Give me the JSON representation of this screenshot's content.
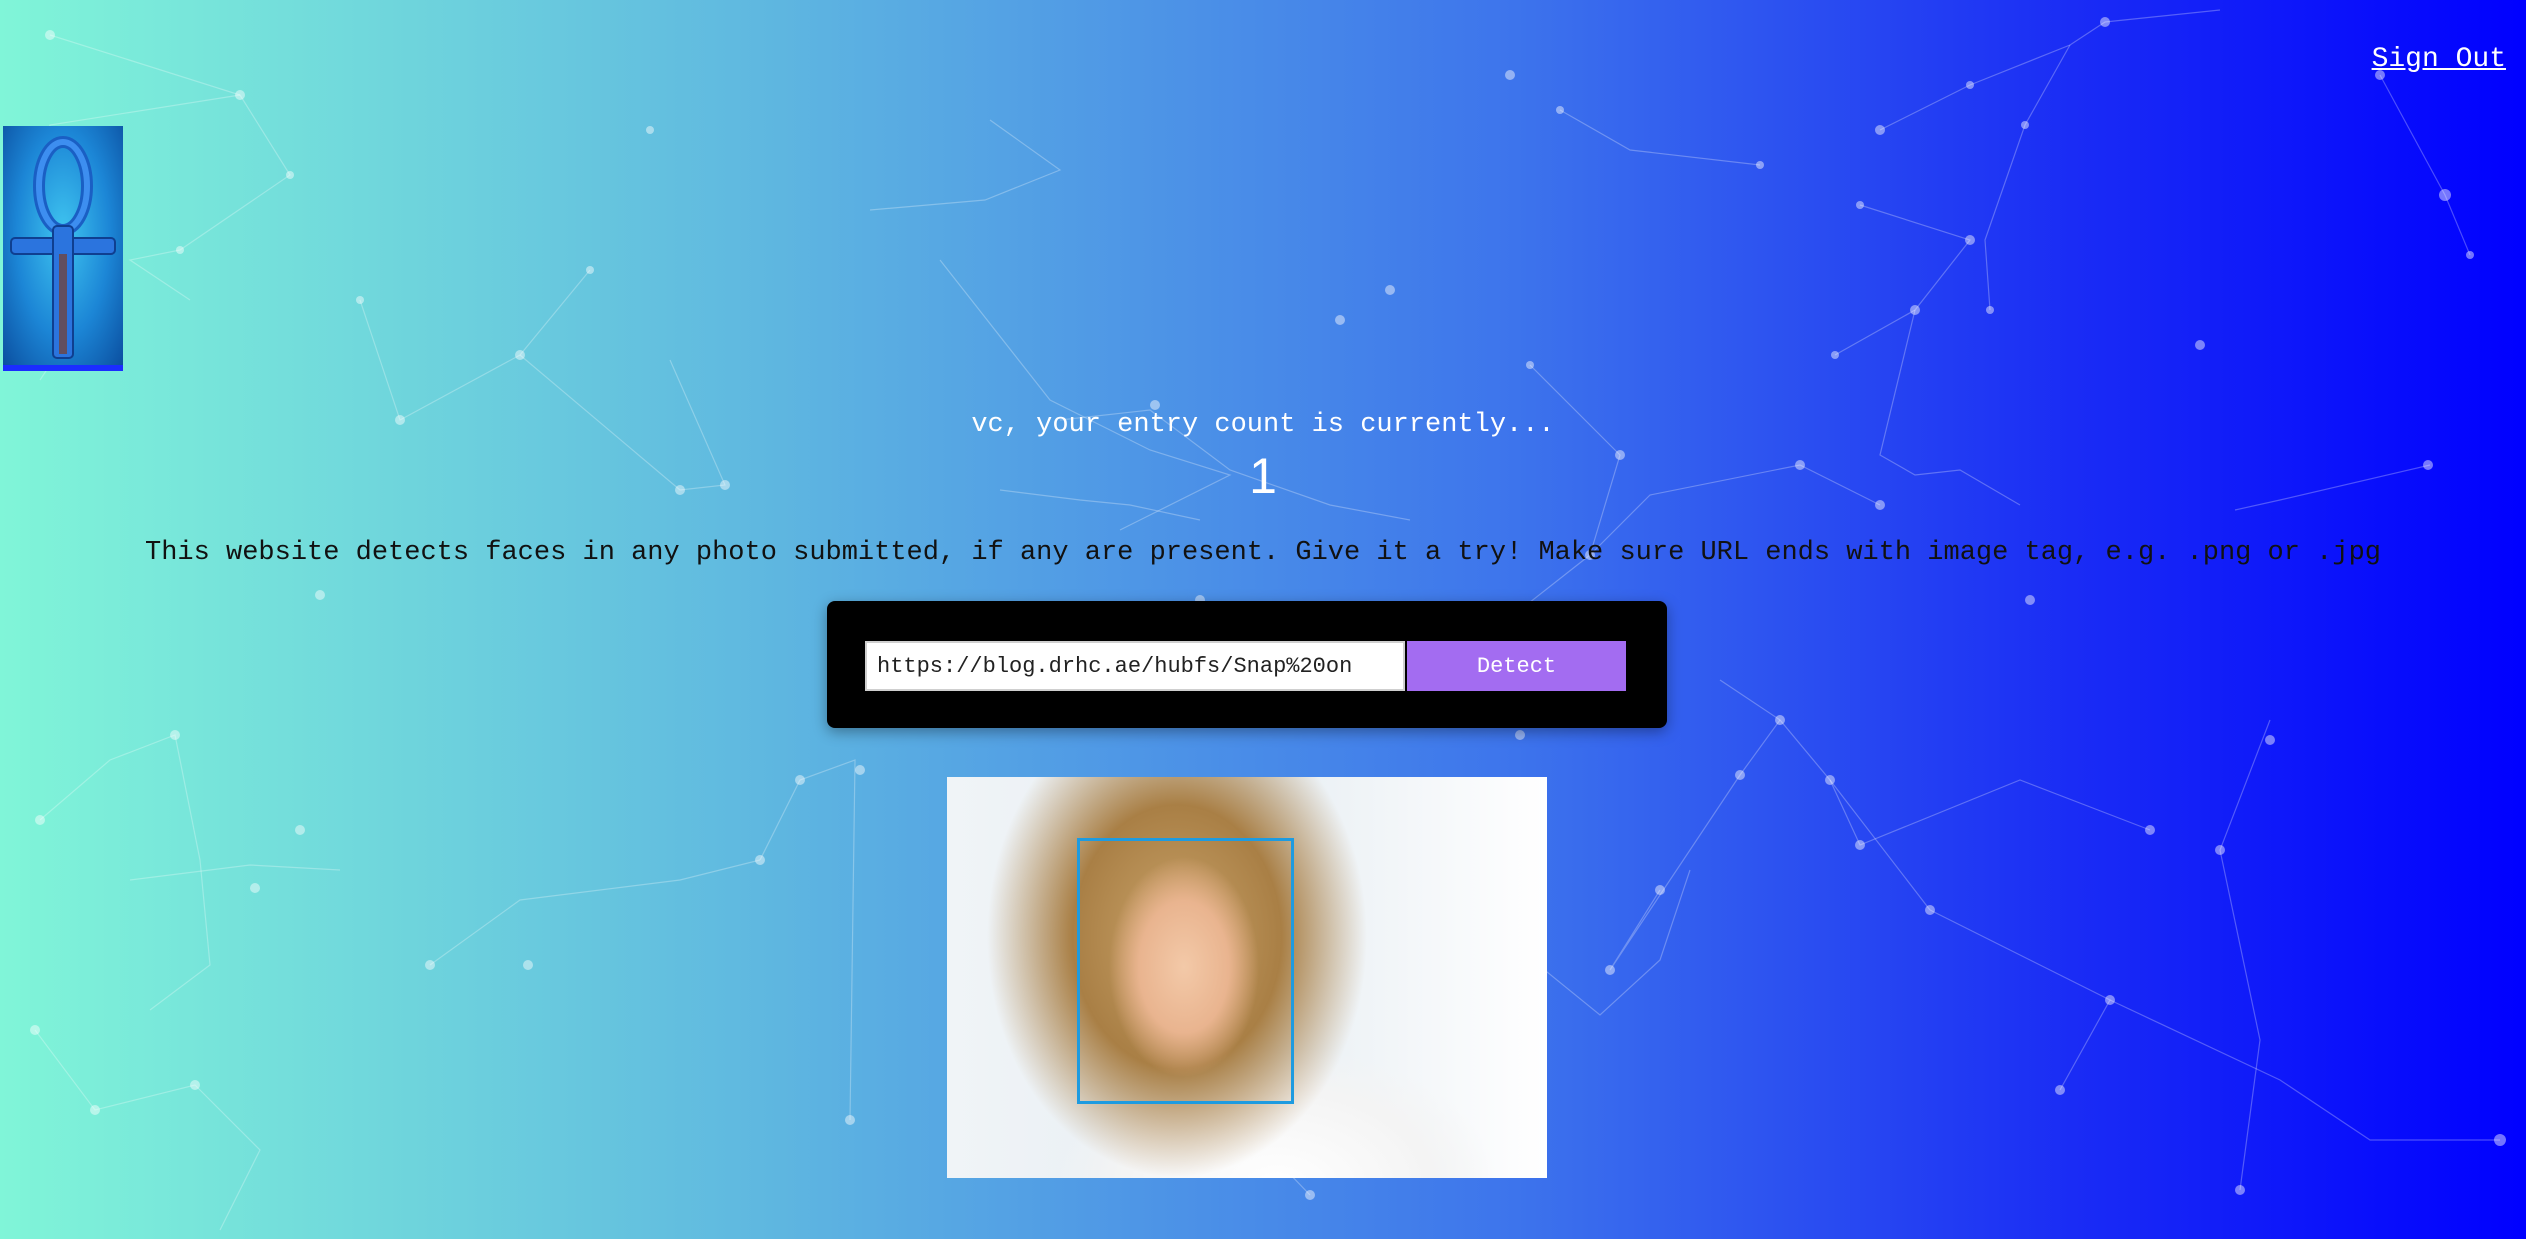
{
  "header": {
    "sign_out_label": "Sign Out",
    "logo_icon": "ankh-icon"
  },
  "main": {
    "entry_text": "vc, your entry count is currently...",
    "entry_count": "1",
    "description": "This website detects faces in any photo submitted, if any are present. Give it a try! Make sure URL ends with image tag, e.g. .png or .jpg"
  },
  "form": {
    "url_value": "https://blog.drhc.ae/hubfs/Snap%20on",
    "detect_label": "Detect"
  },
  "result": {
    "faces_detected": 1
  },
  "colors": {
    "gradient_start": "#80f5d8",
    "gradient_end": "#0000ff",
    "detect_button": "#a36cf1",
    "face_box": "#1e9be0"
  }
}
